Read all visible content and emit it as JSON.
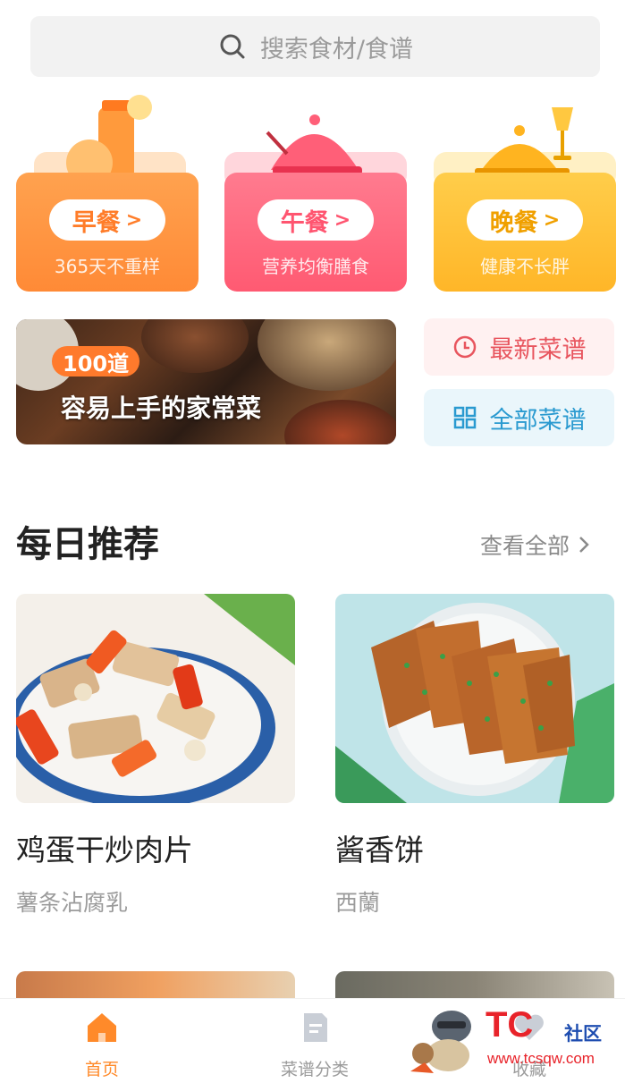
{
  "search": {
    "placeholder": "搜索食材/食谱"
  },
  "meals": [
    {
      "label": "早餐",
      "sub": "365天不重样"
    },
    {
      "label": "午餐",
      "sub": "营养均衡膳食"
    },
    {
      "label": "晚餐",
      "sub": "健康不长胖"
    }
  ],
  "banner": {
    "badge": "100道",
    "tagline": "容易上手的家常菜"
  },
  "quick_links": {
    "latest": "最新菜谱",
    "all": "全部菜谱"
  },
  "daily": {
    "title": "每日推荐",
    "view_all": "查看全部"
  },
  "recipes": [
    {
      "name": "鸡蛋干炒肉片",
      "author": "薯条沾腐乳"
    },
    {
      "name": "酱香饼",
      "author": "西蘭"
    }
  ],
  "tabs": [
    {
      "label": "首页",
      "icon": "home-icon",
      "active": true
    },
    {
      "label": "菜谱分类",
      "icon": "category-icon",
      "active": false
    },
    {
      "label": "收藏",
      "icon": "favorite-icon",
      "active": false
    }
  ],
  "watermark": {
    "brand": "TC",
    "community": "社区",
    "url": "www.tcsqw.com"
  },
  "colors": {
    "accent": "#ff8a2a",
    "breakfast": "#ff8a36",
    "lunch": "#ff5a72",
    "dinner": "#ffb628"
  }
}
